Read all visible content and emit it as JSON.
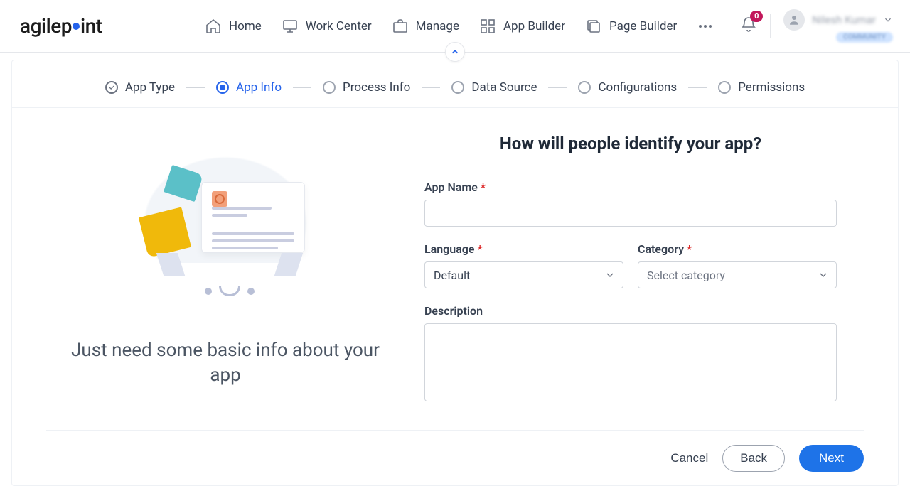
{
  "brand": {
    "name": "agilepoint"
  },
  "nav": {
    "items": [
      {
        "label": "Home"
      },
      {
        "label": "Work Center"
      },
      {
        "label": "Manage"
      },
      {
        "label": "App Builder"
      },
      {
        "label": "Page Builder"
      }
    ],
    "notification_count": "0",
    "user_name": "Nilesh Kumar",
    "user_tag": "COMMUNITY"
  },
  "stepper": {
    "steps": [
      {
        "label": "App Type",
        "state": "done"
      },
      {
        "label": "App Info",
        "state": "active"
      },
      {
        "label": "Process Info",
        "state": "todo"
      },
      {
        "label": "Data Source",
        "state": "todo"
      },
      {
        "label": "Configurations",
        "state": "todo"
      },
      {
        "label": "Permissions",
        "state": "todo"
      }
    ]
  },
  "left": {
    "caption": "Just need some basic info about your app"
  },
  "form": {
    "title": "How will people identify your app?",
    "app_name": {
      "label": "App Name",
      "value": ""
    },
    "language": {
      "label": "Language",
      "value": "Default"
    },
    "category": {
      "label": "Category",
      "placeholder": "Select category"
    },
    "description": {
      "label": "Description",
      "value": ""
    }
  },
  "footer": {
    "cancel": "Cancel",
    "back": "Back",
    "next": "Next"
  }
}
